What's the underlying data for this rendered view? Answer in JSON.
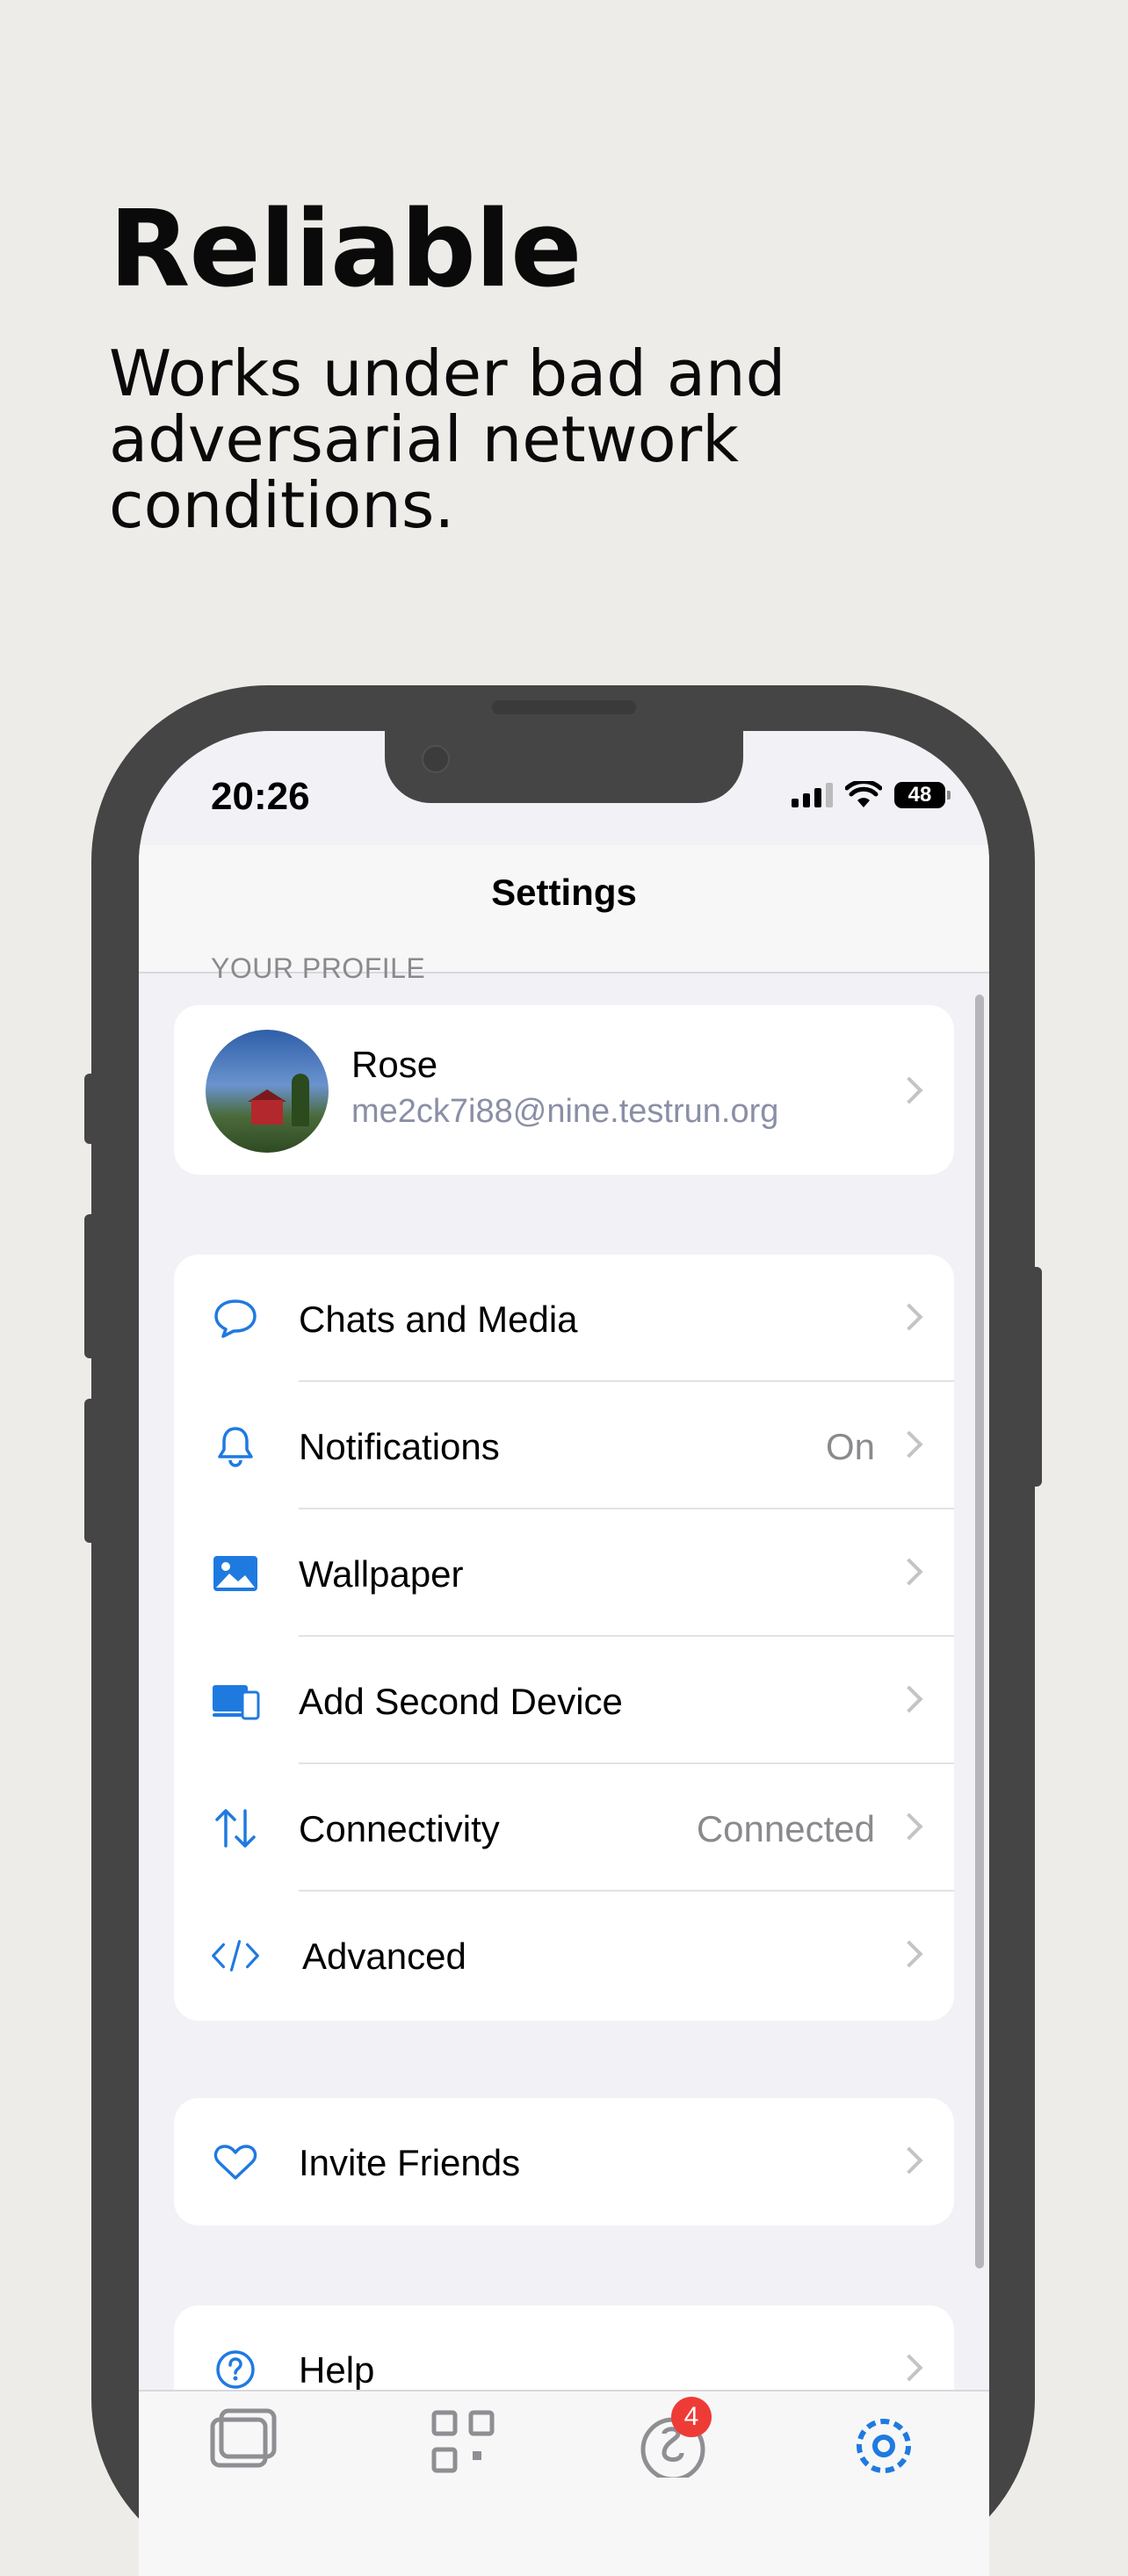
{
  "headline": "Reliable",
  "subhead": "Works under bad and adversarial network conditions.",
  "status_bar": {
    "time": "20:26",
    "battery": "48"
  },
  "nav": {
    "title": "Settings"
  },
  "profile_section": {
    "label": "YOUR PROFILE",
    "name": "Rose",
    "email": "me2ck7i88@nine.testrun.org"
  },
  "settings_rows": [
    {
      "label": "Chats and Media",
      "value": "",
      "icon": "chat-bubble-icon"
    },
    {
      "label": "Notifications",
      "value": "On",
      "icon": "bell-icon"
    },
    {
      "label": "Wallpaper",
      "value": "",
      "icon": "image-icon"
    },
    {
      "label": "Add Second Device",
      "value": "",
      "icon": "devices-icon"
    },
    {
      "label": "Connectivity",
      "value": "Connected",
      "icon": "arrows-updown-icon"
    },
    {
      "label": "Advanced",
      "value": "",
      "icon": "code-icon"
    }
  ],
  "invite": {
    "label": "Invite Friends",
    "icon": "heart-icon"
  },
  "help": {
    "label": "Help",
    "icon": "question-circle-icon"
  },
  "tabbar": {
    "tabs": [
      "gallery-icon",
      "qr-code-icon",
      "chats-icon",
      "settings-gear-icon"
    ],
    "badge": "4"
  },
  "colors": {
    "accent": "#1f7ae0",
    "background": "#eeece8",
    "frame": "#454545"
  }
}
